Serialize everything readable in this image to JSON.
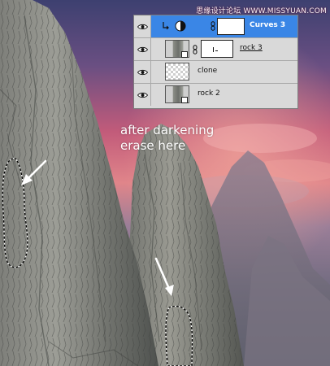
{
  "watermark": "思缘设计论坛 WWW.MISSYUAN.COM",
  "instruction": {
    "line1": "after darkening",
    "line2": "erase here"
  },
  "layers_panel": {
    "layers": [
      {
        "name": "Curves 3",
        "kind": "adjustment",
        "selected": true,
        "visible": true,
        "clipped": true
      },
      {
        "name": "rock 3",
        "kind": "smart-object",
        "selected": false,
        "visible": true,
        "has_mask": true
      },
      {
        "name": "clone",
        "kind": "pixel",
        "selected": false,
        "visible": true
      },
      {
        "name": "rock 2",
        "kind": "smart-object",
        "selected": false,
        "visible": true
      }
    ]
  },
  "colors": {
    "selection": "#3a86e6",
    "panel": "#d9d9d9",
    "annotation": "#ffffff"
  },
  "icons": [
    "eye-icon",
    "clip-arrow-icon",
    "curves-adjustment-icon",
    "mask-link-icon",
    "smart-object-badge"
  ]
}
